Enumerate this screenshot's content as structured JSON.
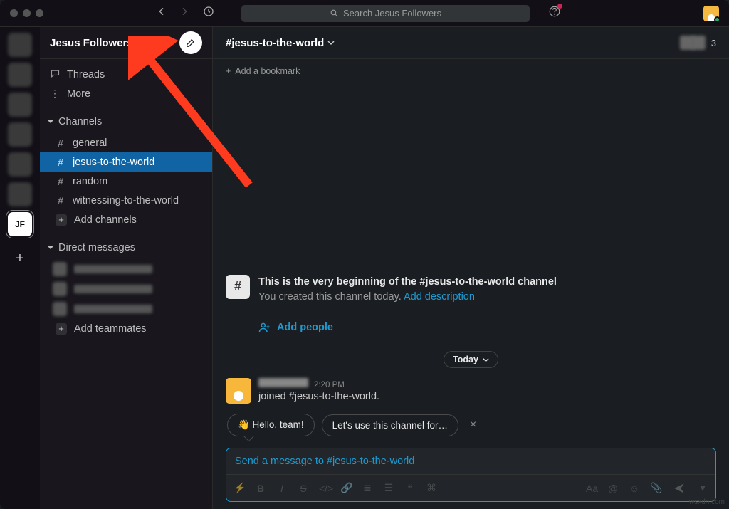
{
  "search": {
    "placeholder": "Search Jesus Followers"
  },
  "workspace": {
    "name": "Jesus Followers",
    "abbrev": "JF"
  },
  "sidebar": {
    "threads": "Threads",
    "more": "More",
    "channels_header": "Channels",
    "channels": [
      {
        "name": "general",
        "selected": false
      },
      {
        "name": "jesus-to-the-world",
        "selected": true
      },
      {
        "name": "random",
        "selected": false
      },
      {
        "name": "witnessing-to-the-world",
        "selected": false
      }
    ],
    "add_channels": "Add channels",
    "dm_header": "Direct messages",
    "add_teammates": "Add teammates"
  },
  "channel": {
    "name": "#jesus-to-the-world",
    "member_count": "3",
    "bookmark": "Add a bookmark",
    "intro_prefix": "This is the very beginning of the ",
    "intro_link": "#jesus-to-the-world",
    "intro_suffix": " channel",
    "intro_sub": "You created this channel today. ",
    "intro_add_desc": "Add description",
    "add_people": "Add people",
    "date": "Today",
    "msg_time": "2:20 PM",
    "msg_body": "joined #jesus-to-the-world.",
    "chip1": "👋 Hello, team!",
    "chip2": "Let's use this channel for…",
    "composer_placeholder": "Send a message to #jesus-to-the-world"
  },
  "watermark": "wsxdn.com"
}
